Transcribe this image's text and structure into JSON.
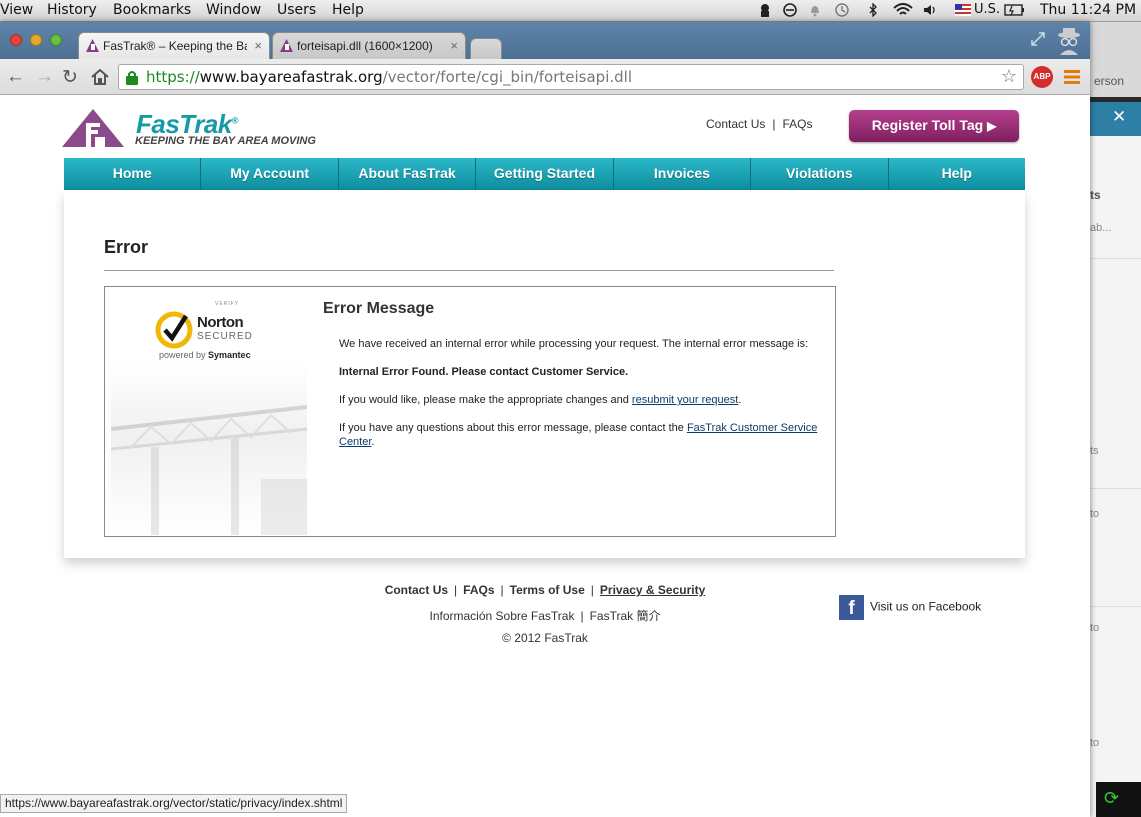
{
  "menubar": {
    "items": [
      "View",
      "History",
      "Bookmarks",
      "Window",
      "Users",
      "Help"
    ],
    "input_source": "U.S.",
    "clock": "Thu 11:24 PM"
  },
  "tabs": [
    {
      "title": "FasTrak® – Keeping the Ba",
      "close": "×"
    },
    {
      "title": "forteisapi.dll (1600×1200)",
      "close": "×"
    }
  ],
  "address_bar": {
    "scheme": "https://",
    "host": "www.bayareafastrak.org",
    "path": "/vector/forte/cgi_bin/forteisapi.dll"
  },
  "page": {
    "logo_text": "FasTrak",
    "logo_registered": "®",
    "tagline": "KEEPING THE BAY AREA MOVING",
    "top_links": [
      "Contact Us",
      "FAQs"
    ],
    "register_button": "Register Toll Tag",
    "nav": [
      "Home",
      "My Account",
      "About FasTrak",
      "Getting Started",
      "Invoices",
      "Violations",
      "Help"
    ],
    "heading": "Error",
    "norton": {
      "verify": "VERIFY",
      "name": "Norton",
      "secured": "SECURED",
      "powered_by": "powered by",
      "brand": "Symantec"
    },
    "error_title": "Error Message",
    "line1": "We have received an internal error while processing your request. The internal error message is:",
    "line2": "Internal Error Found. Please contact Customer Service.",
    "line3_pre": "If you would like, please make the appropriate changes and ",
    "line3_link": "resubmit your request",
    "line3_post": ".",
    "line4_pre": "If you have any questions about this error message, please contact the ",
    "line4_link": "FasTrak Customer Service Center",
    "line4_post": ".",
    "footer_links": [
      "Contact Us",
      "FAQs",
      "Terms of Use",
      "Privacy & Security"
    ],
    "footer_lang": [
      "Información Sobre FasTrak",
      "FasTrak 簡介"
    ],
    "copyright": "© 2012 FasTrak",
    "facebook": "Visit us on Facebook"
  },
  "status_url": "https://www.bayareafastrak.org/vector/static/privacy/index.shtml",
  "background_app": {
    "fragments": [
      "erson",
      "ts",
      "ab...",
      "ts",
      "to",
      "to",
      "to"
    ]
  },
  "colors": {
    "teal": "#139aab",
    "register": "#9b2d78",
    "link": "#0a3c6c"
  }
}
